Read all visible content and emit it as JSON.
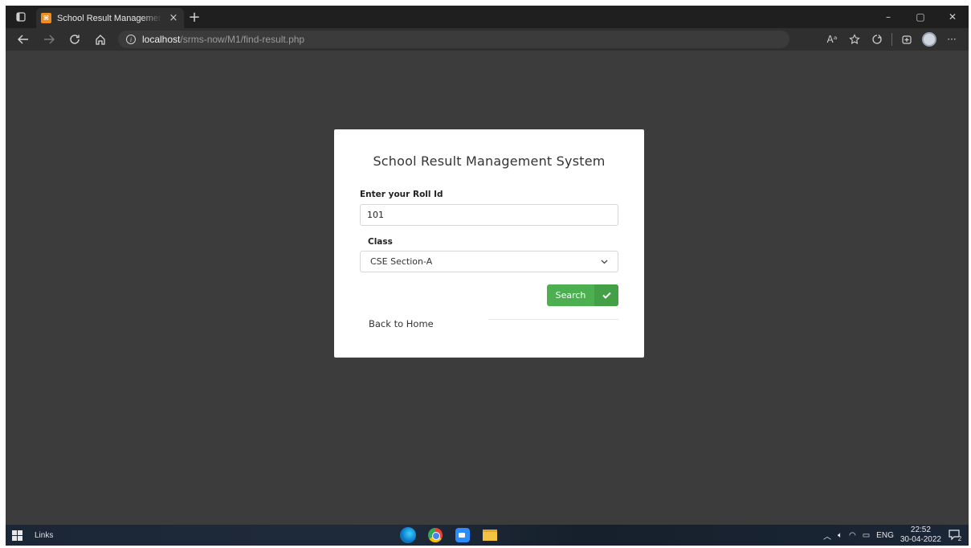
{
  "browser": {
    "tab_title": "School Result Management System",
    "tab_close": "×",
    "new_tab": "+",
    "url_host": "localhost",
    "url_path": "/srms-now/M1/find-result.php",
    "window_controls": {
      "minimize": "–",
      "maximize": "▢",
      "close": "✕"
    },
    "toolbar_icons": [
      "back-icon",
      "forward-icon",
      "refresh-icon",
      "home-icon",
      "info-icon",
      "read-aloud-icon",
      "favorites-add-icon",
      "favorites-icon",
      "collections-icon",
      "profile-icon",
      "more-icon"
    ],
    "read_aloud_label": "Aᵃ",
    "more_label": "···"
  },
  "card": {
    "title": "School Result Management System",
    "roll_label": "Enter your Roll Id",
    "roll_value": "101",
    "class_label": "Class",
    "class_value": "CSE Section-A",
    "search_label": "Search",
    "back_home_label": "Back to Home"
  },
  "taskbar": {
    "links_label": "Links",
    "language": "ENG",
    "time": "22:52",
    "date": "30-04-2022",
    "notification_count": "2"
  },
  "colors": {
    "background": "#3c3c3c",
    "card": "#ffffff",
    "search_button": "#4caf50",
    "tab_favicon": "#f28b1e"
  }
}
